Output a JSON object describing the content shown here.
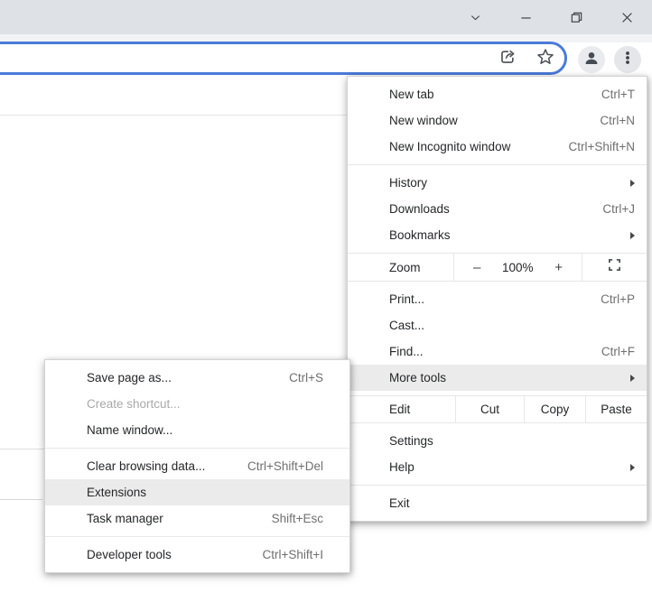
{
  "window": {
    "controls": [
      "chevron-down",
      "minimize",
      "restore",
      "close"
    ]
  },
  "toolbar": {
    "icons": [
      "share",
      "bookmark-star",
      "profile",
      "menu-three-dots"
    ]
  },
  "menu": {
    "items_new": [
      {
        "label": "New tab",
        "shortcut": "Ctrl+T"
      },
      {
        "label": "New window",
        "shortcut": "Ctrl+N"
      },
      {
        "label": "New Incognito window",
        "shortcut": "Ctrl+Shift+N"
      }
    ],
    "items_nav": [
      {
        "label": "History",
        "has_submenu": true
      },
      {
        "label": "Downloads",
        "shortcut": "Ctrl+J"
      },
      {
        "label": "Bookmarks",
        "has_submenu": true
      }
    ],
    "zoom": {
      "label": "Zoom",
      "minus": "–",
      "level": "100%",
      "plus": "+",
      "fullscreen_icon": "fullscreen"
    },
    "items_page": [
      {
        "label": "Print...",
        "shortcut": "Ctrl+P"
      },
      {
        "label": "Cast..."
      },
      {
        "label": "Find...",
        "shortcut": "Ctrl+F"
      },
      {
        "label": "More tools",
        "has_submenu": true,
        "highlighted": true
      }
    ],
    "edit": {
      "label": "Edit",
      "cut": "Cut",
      "copy": "Copy",
      "paste": "Paste"
    },
    "items_settings": [
      {
        "label": "Settings"
      },
      {
        "label": "Help",
        "has_submenu": true
      }
    ],
    "exit": {
      "label": "Exit"
    }
  },
  "submenu": {
    "items_save": [
      {
        "label": "Save page as...",
        "shortcut": "Ctrl+S"
      },
      {
        "label": "Create shortcut...",
        "disabled": true
      },
      {
        "label": "Name window..."
      }
    ],
    "items_tools": [
      {
        "label": "Clear browsing data...",
        "shortcut": "Ctrl+Shift+Del"
      },
      {
        "label": "Extensions",
        "highlighted": true
      },
      {
        "label": "Task manager",
        "shortcut": "Shift+Esc"
      }
    ],
    "items_dev": [
      {
        "label": "Developer tools",
        "shortcut": "Ctrl+Shift+I"
      }
    ]
  },
  "colors": {
    "accent_blue": "#4a7bd9",
    "titlebar_bg": "#dee1e6",
    "menu_highlight": "#ebebeb",
    "text": "#242628",
    "shortcut_text": "#6f6f6f",
    "disabled_text": "#a9a9a9",
    "icon": "#4c5157"
  }
}
